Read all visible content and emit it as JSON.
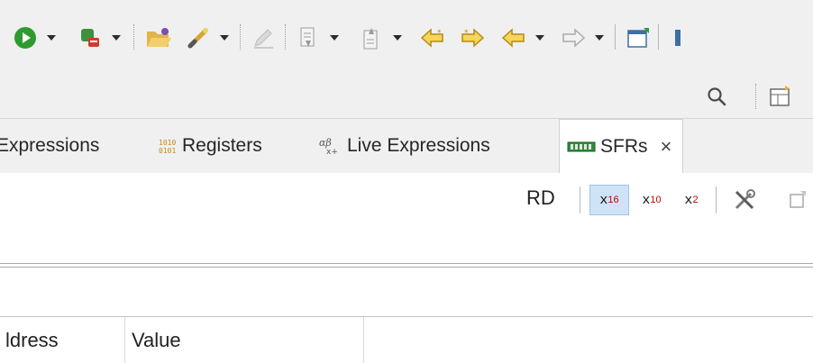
{
  "toolbar": {
    "icons": [
      "run-icon",
      "debug-icon",
      "open-folder-icon",
      "wand-icon",
      "pen-icon",
      "insert-icon",
      "export-icon",
      "prev-edit-icon",
      "next-edit-icon",
      "back-icon",
      "forward-icon",
      "new-window-icon"
    ]
  },
  "toolbar2": {
    "icons": [
      "search-icon",
      "perspective-icon"
    ]
  },
  "tabs": [
    {
      "label": "Expressions",
      "icon": "expressions-icon",
      "active": false
    },
    {
      "label": "Registers",
      "icon": "registers-icon",
      "active": false
    },
    {
      "label": "Live Expressions",
      "icon": "live-expressions-icon",
      "active": false
    },
    {
      "label": "SFRs",
      "icon": "sfr-chip-icon",
      "active": true
    }
  ],
  "tab_close": "×",
  "view_toolbar": {
    "rd_label": "RD",
    "radix": [
      {
        "base": "x",
        "sub": "16",
        "selected": true
      },
      {
        "base": "x",
        "sub": "10",
        "selected": false
      },
      {
        "base": "x",
        "sub": "2",
        "selected": false
      }
    ]
  },
  "table": {
    "columns": [
      "ldress",
      "Value"
    ]
  }
}
